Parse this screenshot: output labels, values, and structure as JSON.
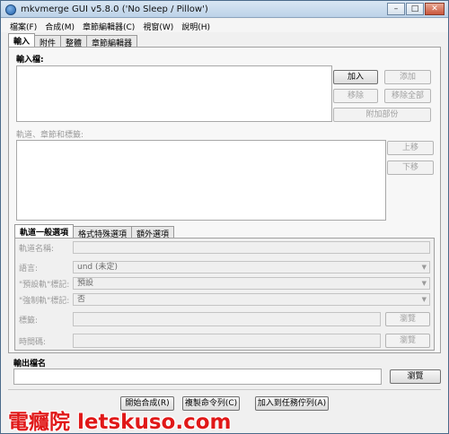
{
  "window": {
    "title": "mkvmerge GUI v5.8.0 ('No Sleep / Pillow')",
    "buttons": {
      "minimize": "–",
      "maximize": "□",
      "close": "✕"
    }
  },
  "menu": [
    "檔案(F)",
    "合成(M)",
    "章節編輯器(C)",
    "視窗(W)",
    "說明(H)"
  ],
  "tabs": [
    "輸入",
    "附件",
    "整體",
    "章節編輯器"
  ],
  "input": {
    "files_label": "輸入檔:",
    "add": "加入",
    "append": "添加",
    "remove": "移除",
    "remove_all": "移除全部",
    "additional_parts": "附加部份",
    "tracks_label": "軌道、章節和標籤:",
    "up": "上移",
    "down": "下移"
  },
  "subtabs": [
    "軌道一般選項",
    "格式特殊選項",
    "額外選項"
  ],
  "options": {
    "track_name_label": "軌道名稱:",
    "language_label": "語言:",
    "language_value": "und (未定)",
    "default_flag_label": "\"預設軌\"標記:",
    "default_flag_value": "預設",
    "forced_flag_label": "\"強制軌\"標記:",
    "forced_flag_value": "否",
    "tags_label": "標籤:",
    "browse1": "瀏覽",
    "timecodes_label": "時間碼:",
    "browse2": "瀏覽"
  },
  "output": {
    "label": "輸出檔名",
    "browse": "瀏覽"
  },
  "bottom": {
    "start": "開始合成(R)",
    "copy_cmd": "複製命令列(C)",
    "add_job": "加入到任務佇列(A)"
  },
  "watermark": "電癮院 letskuso.com"
}
